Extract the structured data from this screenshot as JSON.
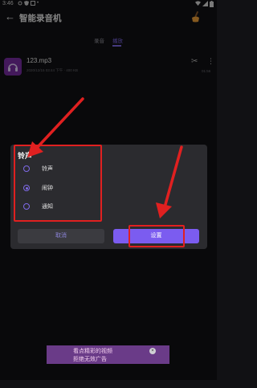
{
  "status_bar": {
    "time": "3:46"
  },
  "app_bar": {
    "title": "智能录音机",
    "back_icon": "arrow-back-icon",
    "clean_icon": "broom-icon"
  },
  "tabs": [
    {
      "label": "录音",
      "active": false
    },
    {
      "label": "播放",
      "active": true
    }
  ],
  "recording": {
    "name": "123.mp3",
    "meta": "2020/12/15 03:44 下午 · 400 KB",
    "duration": "01:56",
    "icon": "headphones-icon",
    "icon_color": "#7a2fa7"
  },
  "dialog": {
    "title": "铃声",
    "options": [
      {
        "label": "铃声",
        "selected": false
      },
      {
        "label": "闹钟",
        "selected": true
      },
      {
        "label": "通知",
        "selected": false
      }
    ],
    "cancel_label": "取消",
    "confirm_label": "设置"
  },
  "ad": {
    "line1": "看点精彩的视频",
    "line2": "拒绝无效广告",
    "close_icon": "close-icon"
  },
  "colors": {
    "accent": "#7b5cf0",
    "annotation": "#e02020"
  }
}
